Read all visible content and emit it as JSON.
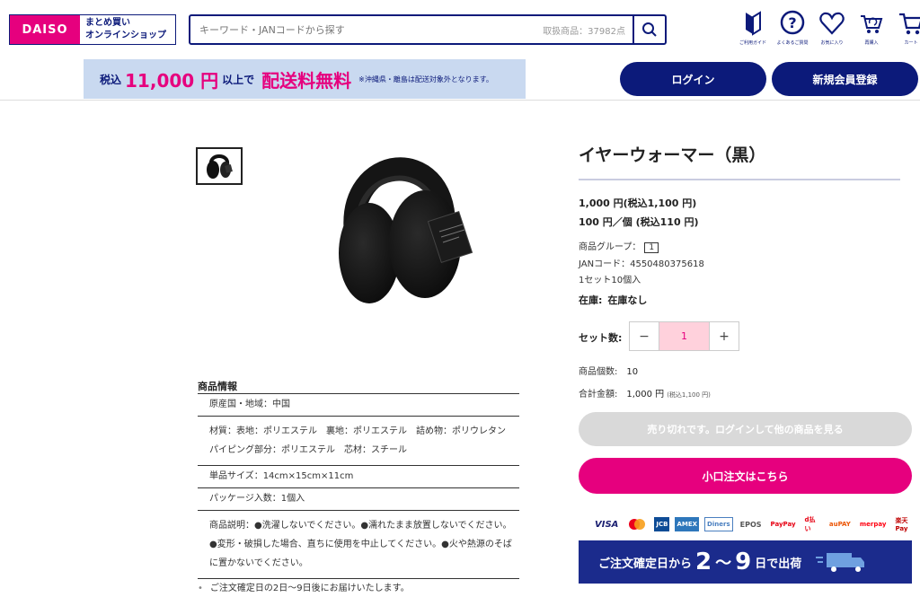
{
  "header": {
    "logo_mark": "DAISO",
    "logo_line1": "まとめ買い",
    "logo_line2": "オンラインショップ",
    "search_placeholder": "キーワード・JANコードから探す",
    "search_count": "取扱商品：37982点",
    "icons": [
      {
        "name": "guide",
        "label": "ご利用ガイド"
      },
      {
        "name": "faq",
        "label": "よくあるご質問"
      },
      {
        "name": "favorite",
        "label": "お気に入り"
      },
      {
        "name": "reorder",
        "label": "再購入"
      },
      {
        "name": "cart",
        "label": "カート"
      }
    ]
  },
  "banner": {
    "pre": "税込",
    "amount": "11,000 円",
    "post": "以上で",
    "free": "配送料無料",
    "note": "※沖縄県・離島は配送対象外となります。"
  },
  "auth": {
    "login": "ログイン",
    "register": "新規会員登録"
  },
  "product": {
    "title": "イヤーウォーマー（黒）",
    "price_set": "1,000 円(税込1,100 円)",
    "price_unit": "100 円／個 (税込110 円)",
    "group_label": "商品グループ：",
    "group_value": "1",
    "jan": "JANコード：4550480375618",
    "set_info": "1セット10個入",
    "stock_label": "在庫:",
    "stock_value": "在庫なし",
    "qty_label": "セット数:",
    "qty_minus": "−",
    "qty_value": "1",
    "qty_plus": "+",
    "count_label": "商品個数:",
    "count_value": "10",
    "total_label": "合計金額:",
    "total_value": "1,000 円",
    "total_tax": "(税込1,100 円)",
    "soldout_button": "売り切れです。ログインして他の商品を見る",
    "small_order_button": "小口注文はこちら"
  },
  "payments": [
    "VISA",
    "MC",
    "JCB",
    "AMEX",
    "Diners",
    "EPOS",
    "PayPay",
    "d払い",
    "auPAY",
    "merpay",
    "楽天Pay"
  ],
  "shipping": {
    "pre": "ご注文確定日から",
    "from": "2",
    "tilde": "〜",
    "to": "9",
    "post": "日で出荷"
  },
  "info": {
    "title": "商品情報",
    "rows": [
      "原産国・地域：中国",
      "材質：表地：ポリエステル　裏地：ポリエステル　詰め物：ポリウレタン　パイピング部分：ポリエステル　芯材：スチール",
      "単品サイズ：14cm×15cm×11cm",
      "パッケージ入数：1個入",
      "商品説明：●洗濯しないでください。●濡れたまま放置しないでください。●変形・破損した場合、直ちに使用を中止してください。●火や熱源のそばに置かないでください。"
    ],
    "note": "ご注文確定日の2日〜9日後にお届けいたします。"
  },
  "colors": {
    "navy": "#0c1a7a",
    "pink": "#e6007e",
    "banner_bg": "#c9d9f0"
  }
}
